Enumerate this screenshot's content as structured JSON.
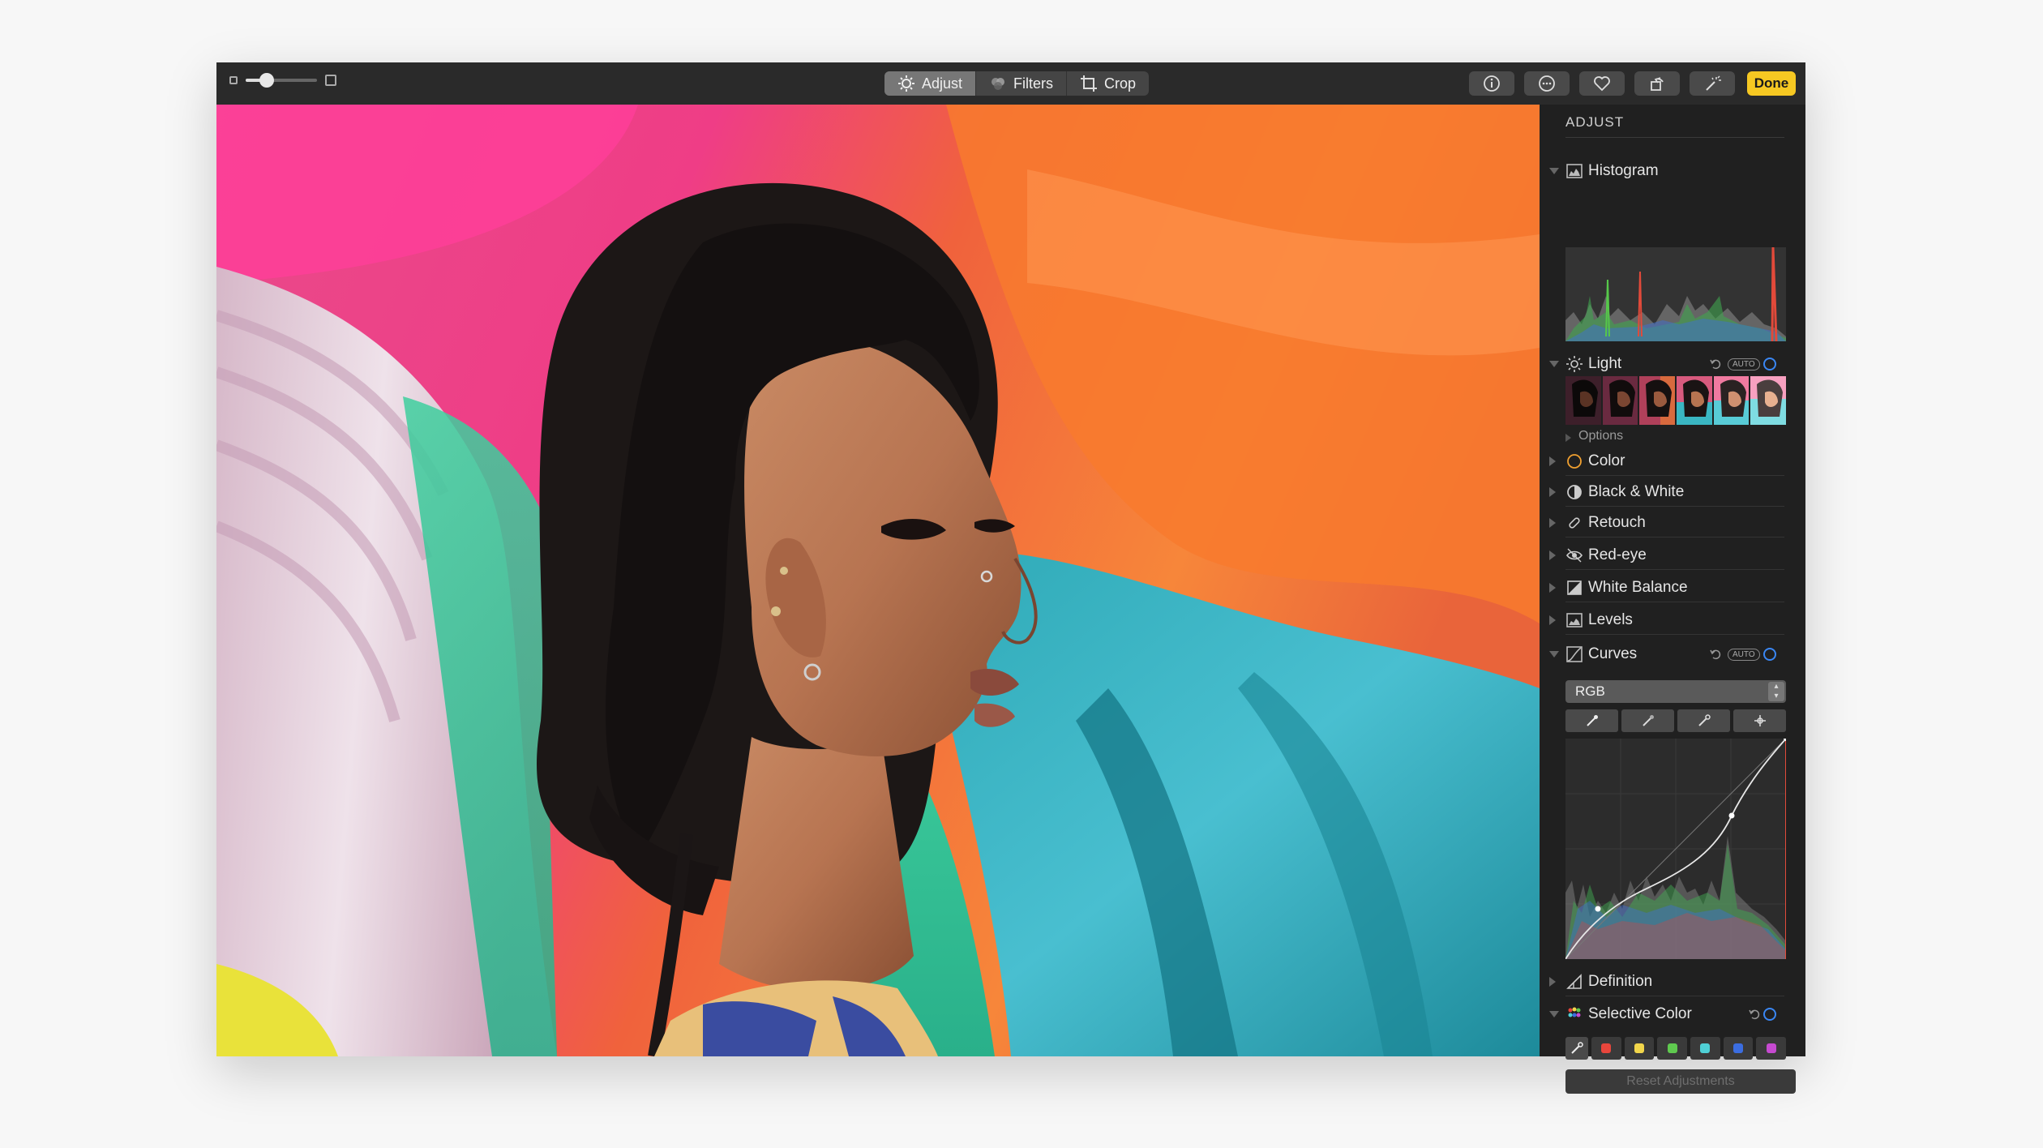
{
  "toolbar": {
    "zoom_level": 0.3,
    "tabs": [
      {
        "label": "Adjust",
        "icon": "adjust-icon",
        "active": true
      },
      {
        "label": "Filters",
        "icon": "filters-icon",
        "active": false
      },
      {
        "label": "Crop",
        "icon": "crop-icon",
        "active": false
      }
    ],
    "buttons": [
      "info-icon",
      "more-icon",
      "heart-icon",
      "rotate-icon",
      "magic-wand-icon"
    ],
    "done_label": "Done",
    "done_color": "#f6c822"
  },
  "sidebar": {
    "header": "ADJUST",
    "histogram": {
      "label": "Histogram",
      "expanded": true
    },
    "light": {
      "label": "Light",
      "auto": "AUTO",
      "options_label": "Options",
      "expanded": true
    },
    "items": [
      {
        "label": "Color",
        "icon": "color-circle-icon"
      },
      {
        "label": "Black & White",
        "icon": "half-circle-icon"
      },
      {
        "label": "Retouch",
        "icon": "bandage-icon"
      },
      {
        "label": "Red-eye",
        "icon": "eye-icon"
      },
      {
        "label": "White Balance",
        "icon": "white-balance-icon"
      },
      {
        "label": "Levels",
        "icon": "levels-icon"
      }
    ],
    "curves": {
      "label": "Curves",
      "auto": "AUTO",
      "channel": "RGB",
      "expanded": true
    },
    "definition": {
      "label": "Definition"
    },
    "selective_color": {
      "label": "Selective Color",
      "swatches": [
        "#e8463c",
        "#f2d64b",
        "#5fc94f",
        "#4fd0d6",
        "#3b6de0",
        "#c64ad0"
      ]
    },
    "reset_label": "Reset Adjustments",
    "accent": "#3a87f4"
  }
}
